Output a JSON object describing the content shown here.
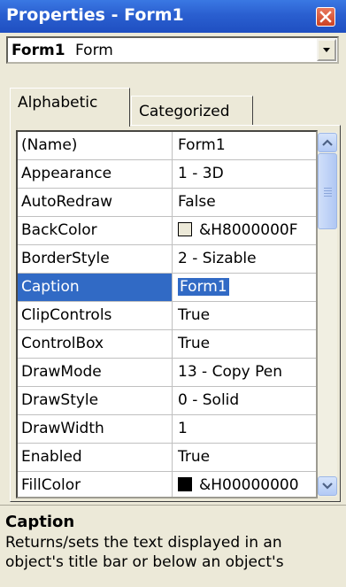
{
  "window": {
    "title": "Properties - Form1"
  },
  "object_selector": {
    "name": "Form1",
    "type": "Form"
  },
  "tabs": [
    {
      "label": "Alphabetic",
      "active": true
    },
    {
      "label": "Categorized",
      "active": false
    }
  ],
  "properties": [
    {
      "name": "(Name)",
      "value": "Form1"
    },
    {
      "name": "Appearance",
      "value": "1 - 3D"
    },
    {
      "name": "AutoRedraw",
      "value": "False"
    },
    {
      "name": "BackColor",
      "value": "&H8000000F",
      "swatch": "#ece9d8"
    },
    {
      "name": "BorderStyle",
      "value": "2 - Sizable"
    },
    {
      "name": "Caption",
      "value": "Form1",
      "selected": true
    },
    {
      "name": "ClipControls",
      "value": "True"
    },
    {
      "name": "ControlBox",
      "value": "True"
    },
    {
      "name": "DrawMode",
      "value": "13 - Copy Pen"
    },
    {
      "name": "DrawStyle",
      "value": "0 - Solid"
    },
    {
      "name": "DrawWidth",
      "value": "1"
    },
    {
      "name": "Enabled",
      "value": "True"
    },
    {
      "name": "FillColor",
      "value": "&H00000000",
      "swatch": "#000000"
    }
  ],
  "description": {
    "title": "Caption",
    "text": "Returns/sets the text displayed in an object's title bar or below an object's"
  },
  "colors": {
    "title_bar": "#2a5fd0",
    "selection": "#316ac5",
    "window_bg": "#ece9d8"
  }
}
